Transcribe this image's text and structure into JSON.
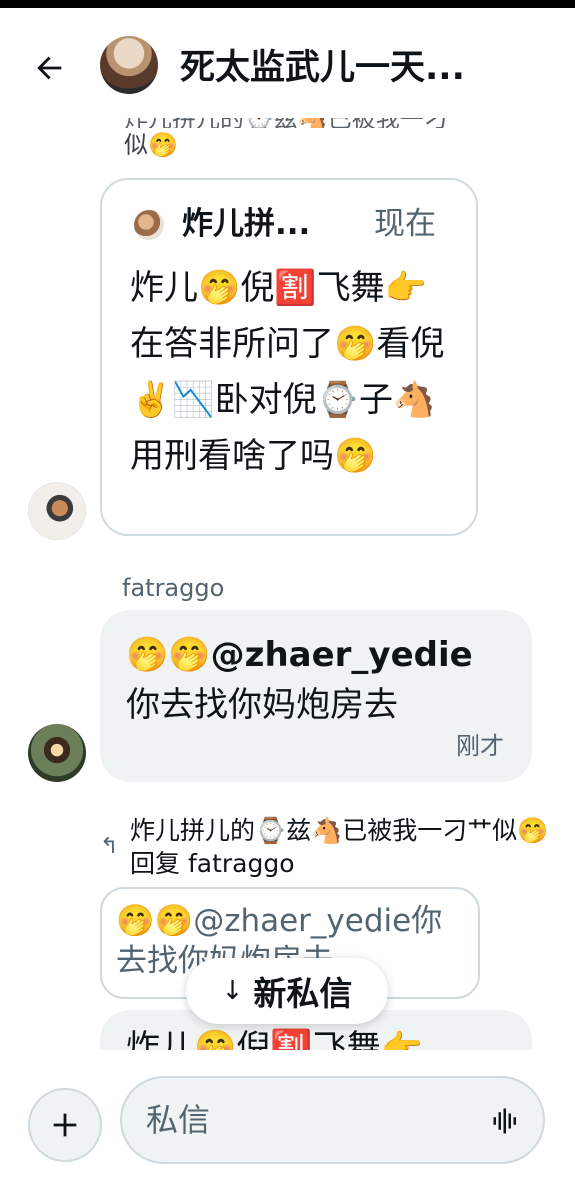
{
  "header": {
    "title": "死太监武儿一天..."
  },
  "quote_top": {
    "cut_line": "炸儿拼儿的⌚兹🐴已被我一刁",
    "line2": "似🤭"
  },
  "quoted_card": {
    "name": "炸儿拼...",
    "time": "现在",
    "body": "炸儿🤭倪🈹飞舞👉在答非所问了🤭看倪✌️📉卧对倪⌚子🐴用刑看啥了吗🤭"
  },
  "received": {
    "sender": "fatraggo",
    "emoji_prefix": "🤭🤭",
    "mention": "@zhaer_yedie",
    "text": "你去找你妈炮房去",
    "time": "刚才"
  },
  "reply": {
    "context": "炸儿拼儿的⌚兹🐴已被我一刁艹似🤭 回复 fatraggo",
    "quote": "🤭🤭@zhaer_yedie你去找你妈炮房去"
  },
  "partial_message": {
    "text": "炸儿🤭倪🈹飞舞👉"
  },
  "new_messages_pill": {
    "label": "新私信"
  },
  "composer": {
    "placeholder": "私信"
  }
}
